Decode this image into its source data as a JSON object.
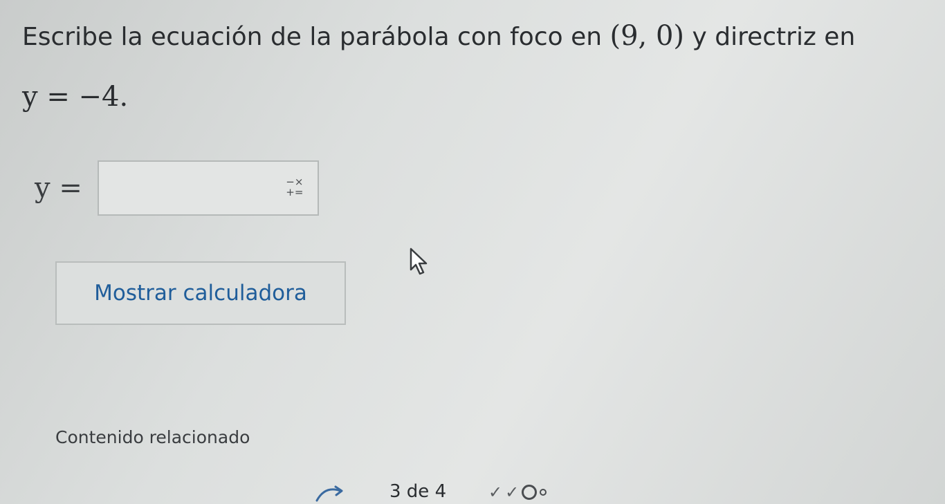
{
  "question": {
    "text_before": "Escribe la ecuación de la parábola con foco en ",
    "focus": "(9, 0)",
    "text_middle": " y directriz en",
    "directrix": "y = −4."
  },
  "answer": {
    "label": "y =",
    "value": "",
    "keypad_icon_top": "−×",
    "keypad_icon_bottom": "+="
  },
  "calculator_button": {
    "label": "Mostrar calculadora"
  },
  "related": {
    "label": "Contenido relacionado"
  },
  "footer": {
    "page_counter": "3 de 4",
    "progress": [
      "check",
      "check",
      "current",
      "pending"
    ]
  }
}
